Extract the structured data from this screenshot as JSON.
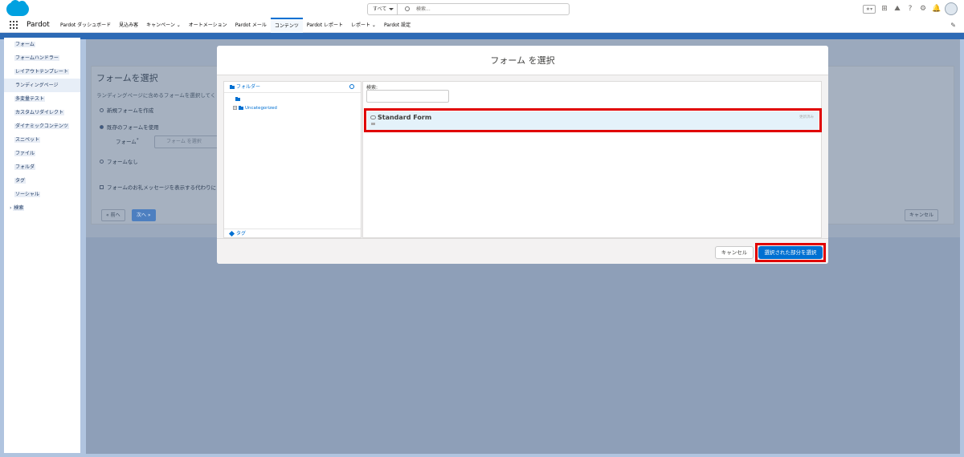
{
  "topbar": {
    "search_scope": "すべて",
    "search_placeholder": "検索..."
  },
  "navbar": {
    "app_name": "Pardot",
    "tabs": [
      {
        "label": "Pardot ダッシュボード"
      },
      {
        "label": "見込み客"
      },
      {
        "label": "キャンペーン"
      },
      {
        "label": "オートメーション"
      },
      {
        "label": "Pardot メール"
      },
      {
        "label": "コンテンツ"
      },
      {
        "label": "Pardot レポート"
      },
      {
        "label": "レポート"
      },
      {
        "label": "Pardot 設定"
      }
    ],
    "active_tab": "コンテンツ"
  },
  "sidebar": {
    "items": [
      {
        "label": "フォーム"
      },
      {
        "label": "フォームハンドラー"
      },
      {
        "label": "レイアウトテンプレート"
      },
      {
        "label": "ランディングページ"
      },
      {
        "label": "多変量テスト"
      },
      {
        "label": "カスタムリダイレクト"
      },
      {
        "label": "ダイナミックコンテンツ"
      },
      {
        "label": "スニペット"
      },
      {
        "label": "ファイル"
      },
      {
        "label": "フォルダ"
      },
      {
        "label": "タグ"
      },
      {
        "label": "ソーシャル"
      },
      {
        "label": "検索"
      }
    ],
    "selected": "ランディングページ"
  },
  "background_page": {
    "title": "フォームを選択",
    "description": "ランディングページに含めるフォームを選択してく",
    "option_new": "新規フォームを作成",
    "option_existing": "既存のフォームを使用",
    "form_label": "フォーム",
    "form_required_mark": "*",
    "form_placeholder": "フォーム を選択",
    "option_none": "フォームなし",
    "checkbox_label": "フォームのお礼メッセージを表示する代わりに",
    "prev_button": "« 前へ",
    "next_button": "次へ »",
    "cancel_button": "キャンセル"
  },
  "modal": {
    "title": "フォーム を選択",
    "folder_header": "フォルダー",
    "folder_child": "Uncategorized",
    "tag_header": "タグ",
    "search_label": "検索:",
    "search_value": "",
    "items": [
      {
        "name": "Standard Form",
        "meta": "更新済み"
      }
    ],
    "cancel_button": "キャンセル",
    "select_button": "選択された部分を選択"
  },
  "colors": {
    "brand": "#00a1e0",
    "accent": "#0070d2",
    "highlight": "#e00000",
    "selected_row": "#e4f2fa"
  }
}
